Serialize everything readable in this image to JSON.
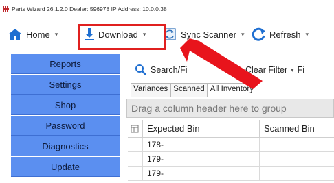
{
  "titlebar": {
    "text": "Parts Wizard 26.1.2.0 Dealer: 596978 IP Address: 10.0.0.38"
  },
  "toolbar": {
    "home_label": "Home",
    "download_label": "Download",
    "sync_label": "Sync Scanner",
    "refresh_label": "Refresh"
  },
  "sidebar": {
    "items": [
      "Reports",
      "Settings",
      "Shop",
      "Password",
      "Diagnostics",
      "Update"
    ]
  },
  "search": {
    "search_label": "Search/Fi",
    "clear_label": "Clear Filter",
    "filter_label": "Fi"
  },
  "tabs": [
    "Variances",
    "Scanned",
    "All Inventory"
  ],
  "grid": {
    "group_hint": "Drag a column header here to group",
    "columns": [
      "Expected Bin",
      "Scanned Bin"
    ],
    "rows": [
      {
        "expected": "178-",
        "scanned": ""
      },
      {
        "expected": "179-",
        "scanned": ""
      },
      {
        "expected": "179-",
        "scanned": ""
      }
    ]
  },
  "colors": {
    "sidebar": "#5b8ff0",
    "highlight": "#e0201f",
    "arrow": "#e8141c",
    "accent": "#1f6fd1"
  }
}
